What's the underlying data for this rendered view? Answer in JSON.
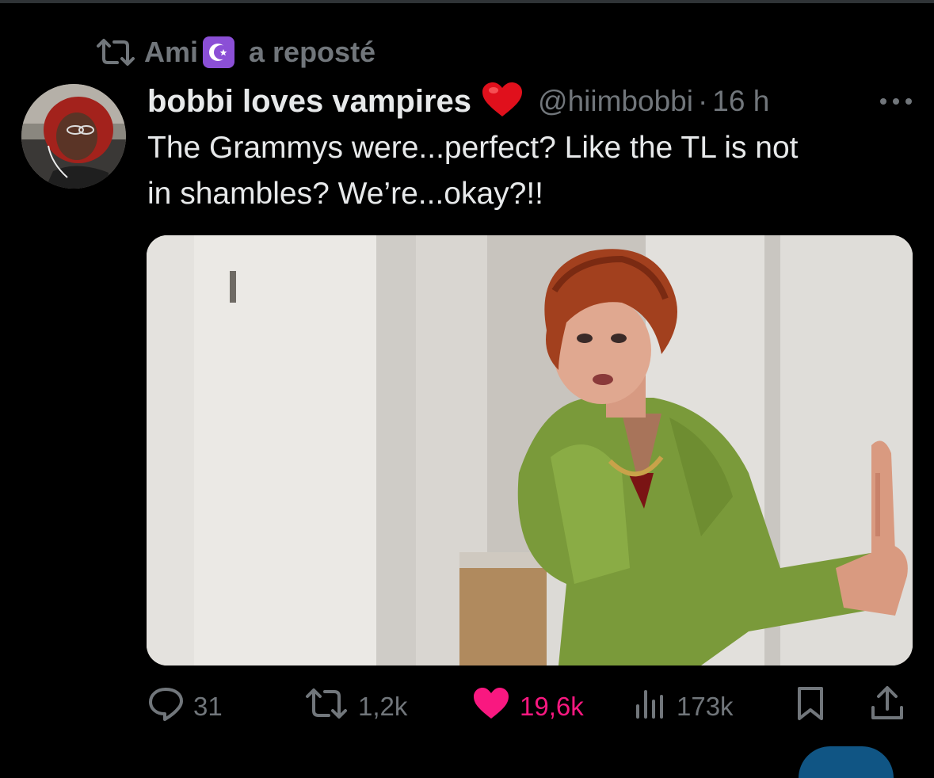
{
  "repost": {
    "icon": "repost-icon",
    "user": "Ami",
    "badge_icon": "star-and-crescent-icon",
    "text": "a reposté"
  },
  "tweet": {
    "avatar": "avatar",
    "display_name": "bobbi loves vampires",
    "name_emoji": "red-heart-icon",
    "handle": "@hiimbobbi",
    "separator": "·",
    "time": "16 h",
    "more_icon": "more-horizontal-icon",
    "text_lines": [
      "The Grammys were...perfect? Like the TL is not",
      "in shambles? We’re...okay?!!"
    ],
    "media": "photo-woman-green-robe"
  },
  "actions": {
    "reply": {
      "icon": "reply-icon",
      "count": "31"
    },
    "repost": {
      "icon": "repost-icon",
      "count": "1,2k"
    },
    "like": {
      "icon": "heart-icon",
      "count": "19,6k",
      "active": true
    },
    "views": {
      "icon": "views-icon",
      "count": "173k"
    },
    "bookmark": {
      "icon": "bookmark-icon"
    },
    "share": {
      "icon": "share-icon"
    }
  },
  "colors": {
    "background": "#000000",
    "text": "#e7e9ea",
    "secondary": "#71767b",
    "like_pink": "#f91880",
    "badge_purple": "#8b4fd6"
  }
}
